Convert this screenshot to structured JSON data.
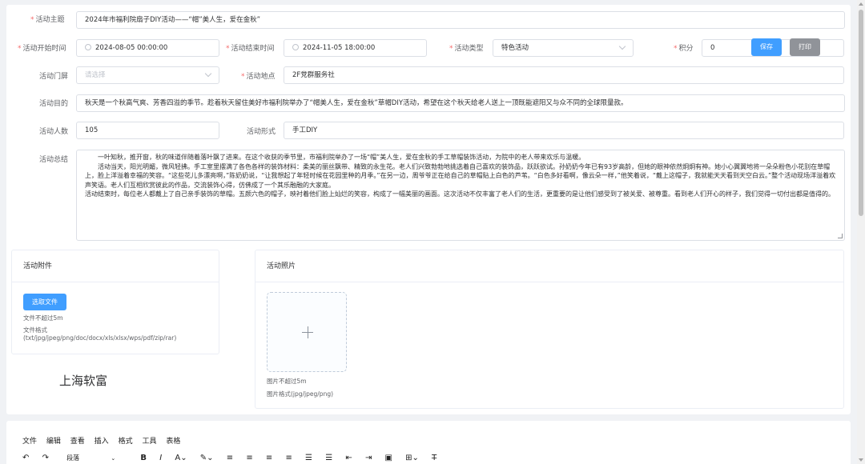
{
  "form": {
    "theme_label": "活动主题",
    "theme_value": "2024年市福利院扇子DIY活动——“帽”美人生，爱在金秋”",
    "start_label": "活动开始时间",
    "start_value": "2024-08-05 00:00:00",
    "end_label": "活动结束时间",
    "end_value": "2024-11-05 18:00:00",
    "type_label": "活动类型",
    "type_value": "特色活动",
    "points_label": "积分",
    "points_value": "0",
    "gate_label": "活动门屏",
    "gate_placeholder": "请选择",
    "location_label": "活动地点",
    "location_value": "2F党群服务社",
    "purpose_label": "活动目的",
    "purpose_value": "秋天是一个秋高气爽、芳香四溢的季节。趁着秋天留住美好市福利院举办了“帽美人生，爱在金秋”草帽DIY活动，希望在这个秋天给老人送上一顶既能遮阳又与众不同的全球限量款。",
    "count_label": "活动人数",
    "count_value": "105",
    "form_label": "活动形式",
    "form_value": "手工DIY",
    "summary_label": "活动总结",
    "summary_lines": [
      "一叶知秋，推开窗，秋的味道伴随着落叶飘了进来。在这个收获的季节里，市福利院举办了一场“帽”美人生，爱在金秋的手工草帽装饰活动，为院中的老人带来欢乐与温暖。",
      "活动当天，阳光明媚，微风轻拂。手工室里摆满了各色各样的装饰材料：柔美的丽丝飘带、精致的永生花。老人们兴致勃勃地挑选着自己喜欢的装饰品，跃跃欲试。孙奶奶今年已有93岁高龄，但她的眼神依然炯炯有神。她小心翼翼地将一朵朵粉色小花别在草帽上，脸上洋溢着幸福的笑容。“这些花儿多漂亮啊，”陈奶奶说，“让我想起了年轻时候在花园里种的月季。”在另一边，周爷爷正在给自己的草帽贴上白色的芦苇。“白色多好看啊，像云朵一样，”他笑着说，“戴上这帽子，我就能天天看到天空白云。”整个活动现场洋溢着欢声笑语。老人们互相欣赏彼此的作品，交流装饰心得，仿佛成了一个其乐融融的大家庭。",
      "活动结束时，每位老人都戴上了自己亲手装饰的草帽。五颜六色的帽子，映衬着他们脸上灿烂的笑容，构成了一幅美丽的画面。这次活动不仅丰富了老人们的生活，更重要的是让他们感受到了被关爱、被尊重。看到老人们开心的样子，我们觉得一切付出都是值得的。"
    ]
  },
  "buttons": {
    "save": "保存",
    "print": "打印"
  },
  "attachments": {
    "title": "活动附件",
    "select_button": "选取文件",
    "size_note": "文件不超过5m",
    "format_note_1": "文件格式",
    "format_note_2": "(txt/jpg/jpeg/png/doc/docx/xls/xlsx/wps/pdf/zip/rar)",
    "watermark": "上海软富"
  },
  "photos": {
    "title": "活动照片",
    "size_note": "图片不超过5m",
    "format_note": "图片格式(jpg/jpeg/png)"
  },
  "editor": {
    "menu": [
      "文件",
      "编辑",
      "查看",
      "插入",
      "格式",
      "工具",
      "表格"
    ],
    "paragraph_select": "段落"
  }
}
